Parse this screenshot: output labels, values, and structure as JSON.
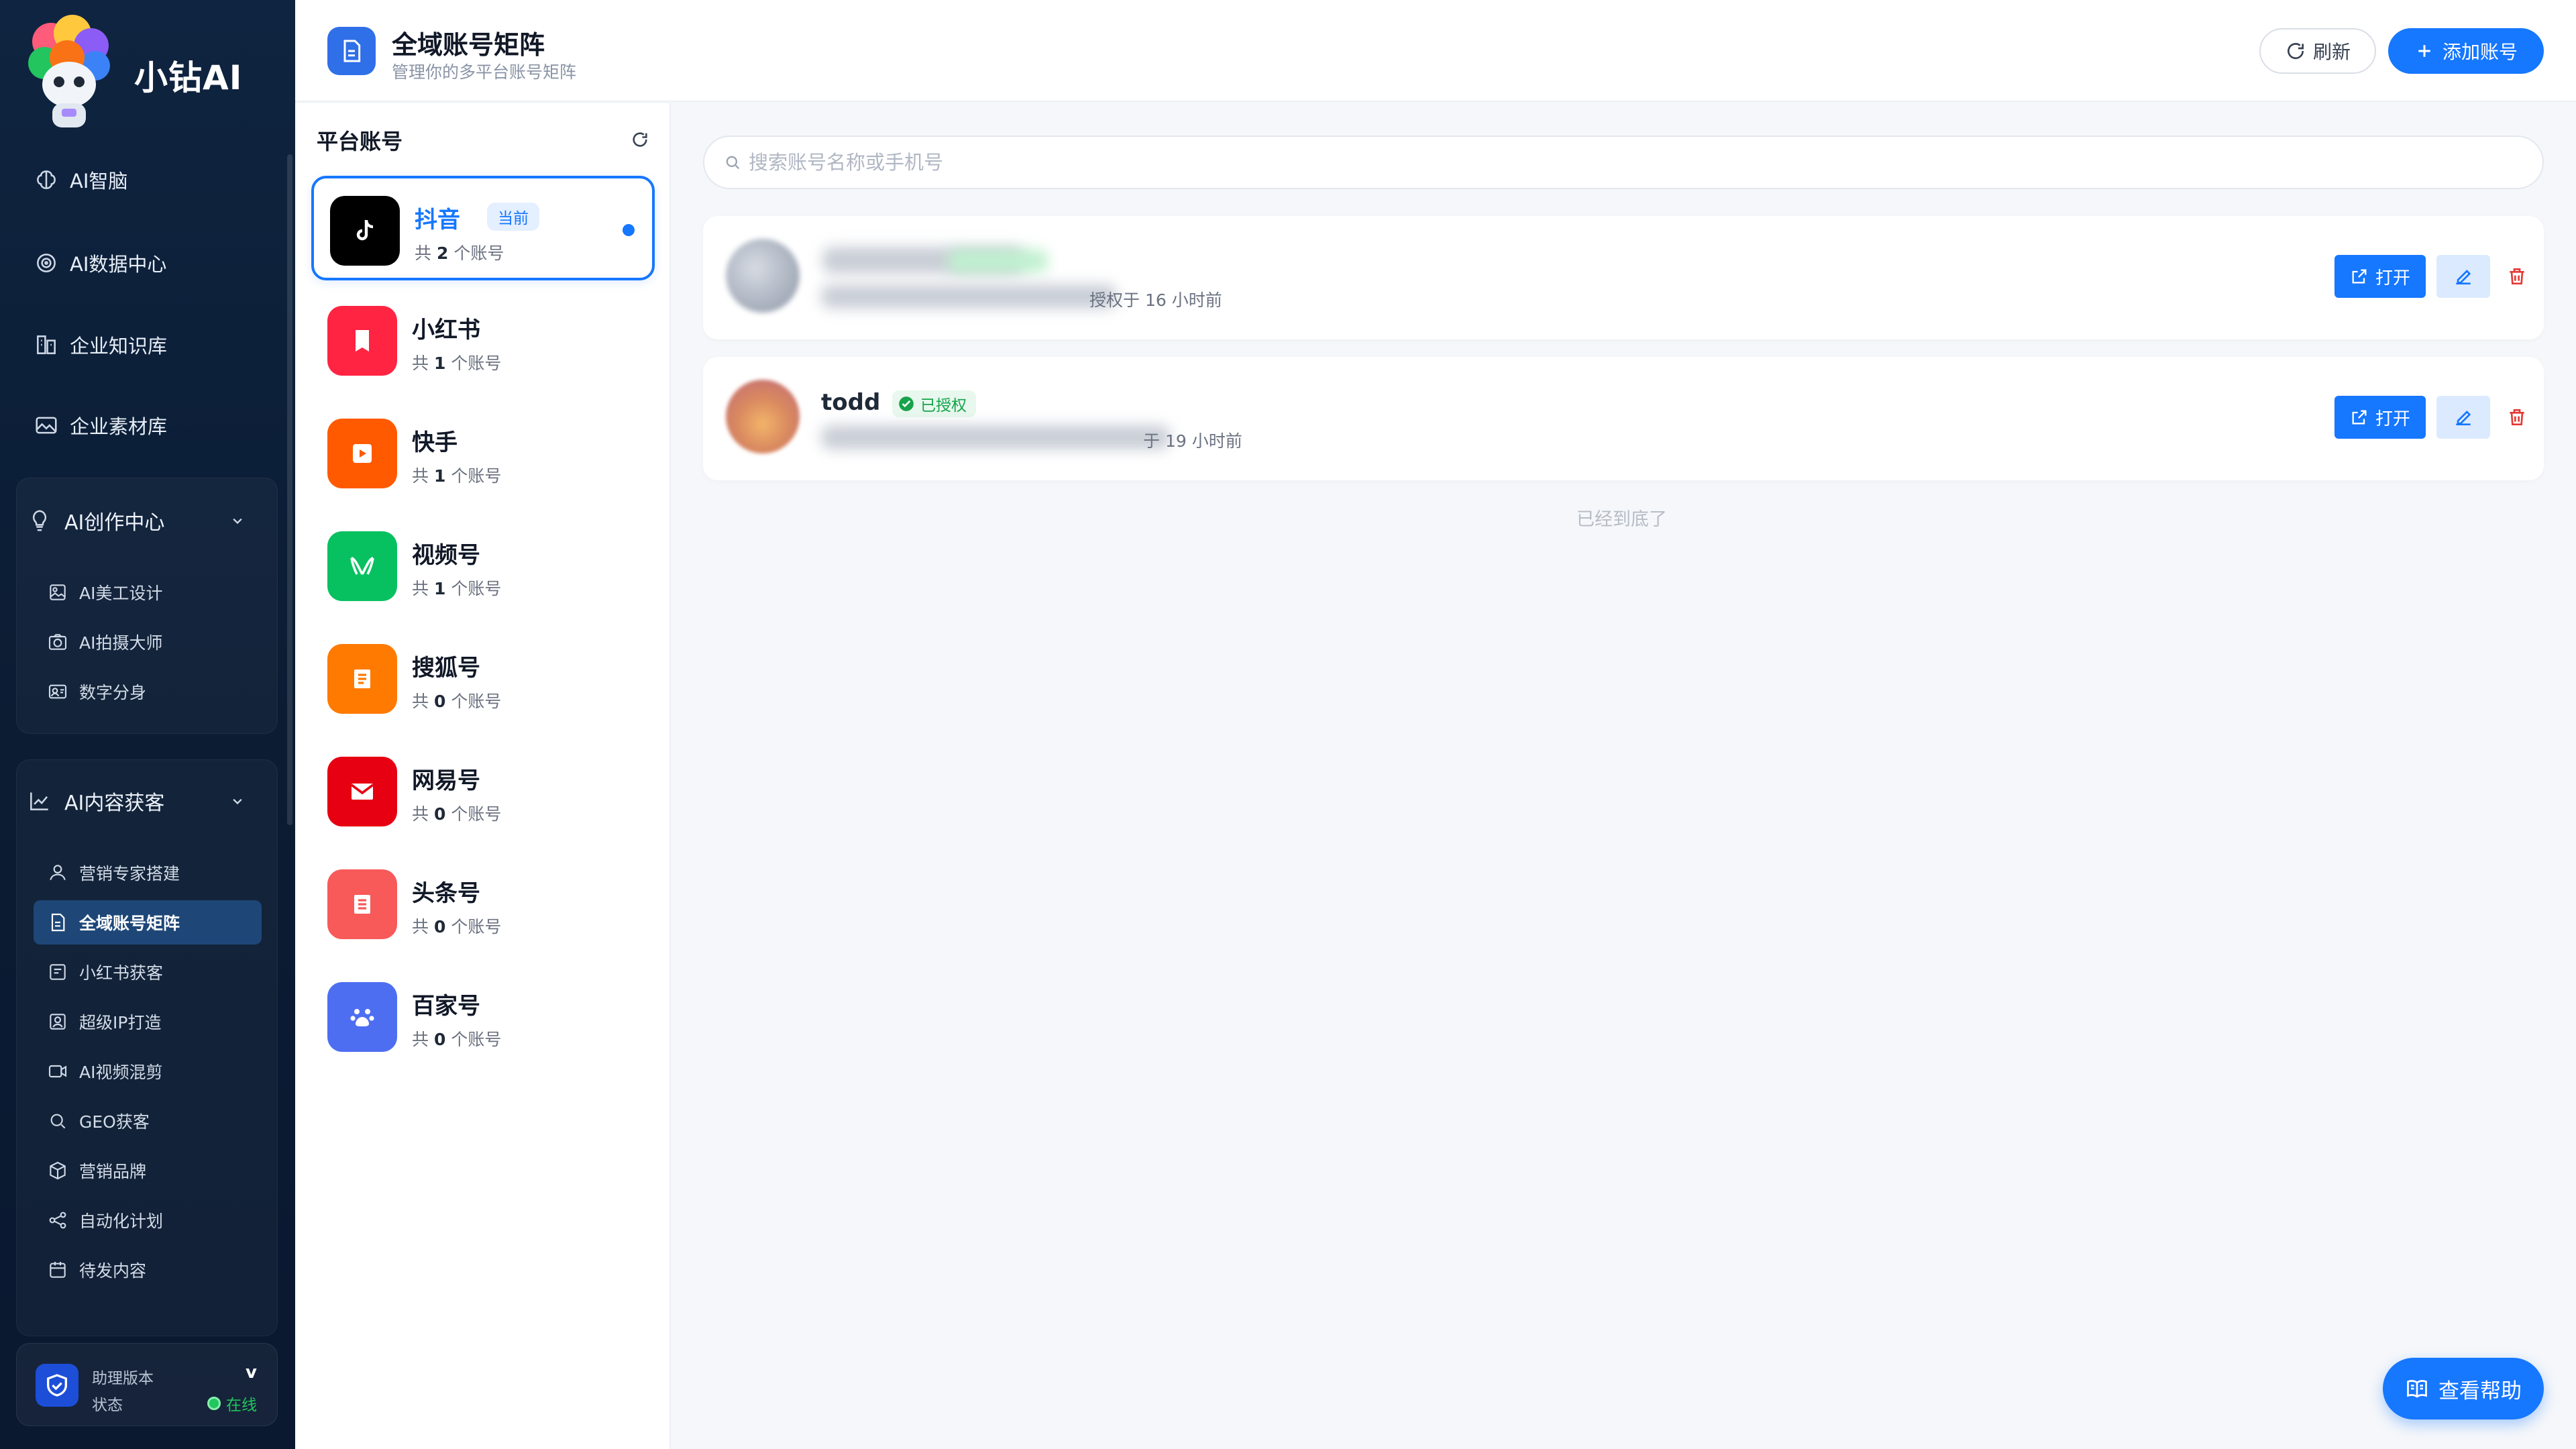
{
  "app": {
    "brand": "小钻AI"
  },
  "sidebar": {
    "top_items": [
      {
        "label": "AI智脑",
        "icon": "brain-icon"
      },
      {
        "label": "AI数据中心",
        "icon": "data-center-icon"
      },
      {
        "label": "企业知识库",
        "icon": "knowledge-base-icon"
      },
      {
        "label": "企业素材库",
        "icon": "asset-library-icon"
      }
    ],
    "groups": [
      {
        "label": "AI创作中心",
        "icon": "lightbulb-icon",
        "items": [
          {
            "label": "AI美工设计",
            "icon": "image-design-icon"
          },
          {
            "label": "AI拍摄大师",
            "icon": "camera-icon"
          },
          {
            "label": "数字分身",
            "icon": "avatar-card-icon"
          }
        ]
      },
      {
        "label": "AI内容获客",
        "icon": "chart-line-icon",
        "items": [
          {
            "label": "营销专家搭建",
            "icon": "user-icon"
          },
          {
            "label": "全域账号矩阵",
            "icon": "document-icon",
            "active": true
          },
          {
            "label": "小红书获客",
            "icon": "xhs-icon"
          },
          {
            "label": "超级IP打造",
            "icon": "ip-icon"
          },
          {
            "label": "AI视频混剪",
            "icon": "video-icon"
          },
          {
            "label": "GEO获客",
            "icon": "search-icon"
          },
          {
            "label": "营销品牌",
            "icon": "box-icon"
          },
          {
            "label": "自动化计划",
            "icon": "share-nodes-icon"
          },
          {
            "label": "待发内容",
            "icon": "calendar-icon"
          }
        ]
      }
    ],
    "status": {
      "version_label": "助理版本",
      "version_value": "v",
      "state_label": "状态",
      "state_value": "在线",
      "online_color": "#22c55e"
    }
  },
  "header": {
    "title": "全域账号矩阵",
    "subtitle": "管理你的多平台账号矩阵",
    "refresh_label": "刷新",
    "add_label": "添加账号"
  },
  "platforms": {
    "title": "平台账号",
    "current_badge": "当前",
    "items": [
      {
        "name": "抖音",
        "count_prefix": "共",
        "count": "2",
        "count_suffix": "个账号",
        "color": "#000000",
        "icon": "tiktok-icon",
        "active": true
      },
      {
        "name": "小红书",
        "count_prefix": "共",
        "count": "1",
        "count_suffix": "个账号",
        "color": "#ff2442",
        "icon": "book-icon"
      },
      {
        "name": "快手",
        "count_prefix": "共",
        "count": "1",
        "count_suffix": "个账号",
        "color": "#ff5a00",
        "icon": "play-icon"
      },
      {
        "name": "视频号",
        "count_prefix": "共",
        "count": "1",
        "count_suffix": "个账号",
        "color": "#07c160",
        "icon": "channels-icon"
      },
      {
        "name": "搜狐号",
        "count_prefix": "共",
        "count": "0",
        "count_suffix": "个账号",
        "color": "#ff7a00",
        "icon": "sohu-icon"
      },
      {
        "name": "网易号",
        "count_prefix": "共",
        "count": "0",
        "count_suffix": "个账号",
        "color": "#e60012",
        "icon": "mail-icon"
      },
      {
        "name": "头条号",
        "count_prefix": "共",
        "count": "0",
        "count_suffix": "个账号",
        "color": "#f85959",
        "icon": "news-icon"
      },
      {
        "name": "百家号",
        "count_prefix": "共",
        "count": "0",
        "count_suffix": "个账号",
        "color": "#4e6ef2",
        "icon": "paw-icon"
      }
    ]
  },
  "search": {
    "placeholder": "搜索账号名称或手机号"
  },
  "accounts": [
    {
      "name": "",
      "meta_visible": "授权于 16 小时前",
      "open_label": "打开"
    },
    {
      "name": "todd",
      "status": "已授权",
      "meta_visible": "于 19 小时前",
      "open_label": "打开"
    }
  ],
  "list_end": "已经到底了",
  "help": {
    "label": "查看帮助"
  },
  "colors": {
    "accent": "#1677ff",
    "sidebar_bg": "#0f2440",
    "danger": "#e53935"
  }
}
